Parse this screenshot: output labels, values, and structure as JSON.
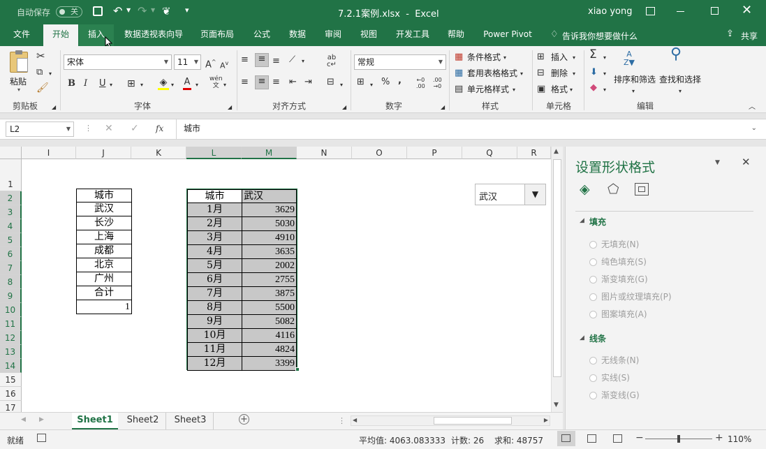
{
  "title_bar": {
    "autosave_label": "自动保存",
    "autosave_state": "关",
    "file_title": "7.2.1案例.xlsx  -  Excel",
    "user": "xiao yong"
  },
  "tabs": [
    "文件",
    "开始",
    "插入",
    "数据透视表向导",
    "页面布局",
    "公式",
    "数据",
    "审阅",
    "视图",
    "开发工具",
    "帮助",
    "Power Pivot"
  ],
  "tell_me": "告诉我你想要做什么",
  "share": "共享",
  "ribbon": {
    "clipboard": {
      "paste": "粘贴",
      "label": "剪贴板"
    },
    "font": {
      "name": "宋体",
      "size": "11",
      "label": "字体",
      "bold": "B",
      "italic": "I",
      "underline": "U",
      "wen": "wén"
    },
    "alignment": {
      "label": "对齐方式"
    },
    "number": {
      "format": "常规",
      "label": "数字"
    },
    "styles": {
      "conditional": "条件格式",
      "table": "套用表格格式",
      "cell": "单元格样式",
      "label": "样式"
    },
    "cells": {
      "insert": "插入",
      "delete": "删除",
      "format": "格式",
      "label": "单元格"
    },
    "editing": {
      "sort": "排序和筛选",
      "find": "查找和选择",
      "label": "编辑"
    }
  },
  "formula_bar": {
    "name_box": "L2",
    "content": "城市",
    "fx": "fx"
  },
  "columns": [
    "I",
    "J",
    "K",
    "L",
    "M",
    "N",
    "O",
    "P",
    "Q",
    "R"
  ],
  "rows": [
    "1",
    "2",
    "3",
    "4",
    "5",
    "6",
    "7",
    "8",
    "9",
    "10",
    "11",
    "12",
    "13",
    "14",
    "15",
    "16",
    "17"
  ],
  "city_list": [
    "城市",
    "武汉",
    "长沙",
    "上海",
    "成都",
    "北京",
    "广州",
    "合计"
  ],
  "index_value": "1",
  "table": {
    "header": [
      "城市",
      "武汉"
    ],
    "rows": [
      [
        "1月",
        "3629"
      ],
      [
        "2月",
        "5030"
      ],
      [
        "3月",
        "4910"
      ],
      [
        "4月",
        "3635"
      ],
      [
        "5月",
        "2002"
      ],
      [
        "6月",
        "2755"
      ],
      [
        "7月",
        "3875"
      ],
      [
        "8月",
        "5500"
      ],
      [
        "9月",
        "5082"
      ],
      [
        "10月",
        "4116"
      ],
      [
        "11月",
        "4824"
      ],
      [
        "12月",
        "3399"
      ]
    ]
  },
  "combo": {
    "value": "武汉"
  },
  "pane": {
    "title": "设置形状格式",
    "fill_section": "填充",
    "fill_options": [
      "无填充(N)",
      "纯色填充(S)",
      "渐变填充(G)",
      "图片或纹理填充(P)",
      "图案填充(A)"
    ],
    "line_section": "线条",
    "line_options": [
      "无线条(N)",
      "实线(S)",
      "渐变线(G)"
    ]
  },
  "sheets": [
    "Sheet1",
    "Sheet2",
    "Sheet3"
  ],
  "status": {
    "mode": "就绪",
    "average": "平均值: 4063.083333",
    "count": "计数: 26",
    "sum": "求和: 48757",
    "zoom": "110%"
  },
  "colors": {
    "excel_green": "#217346",
    "selection_shade": "#c8c8c8"
  }
}
